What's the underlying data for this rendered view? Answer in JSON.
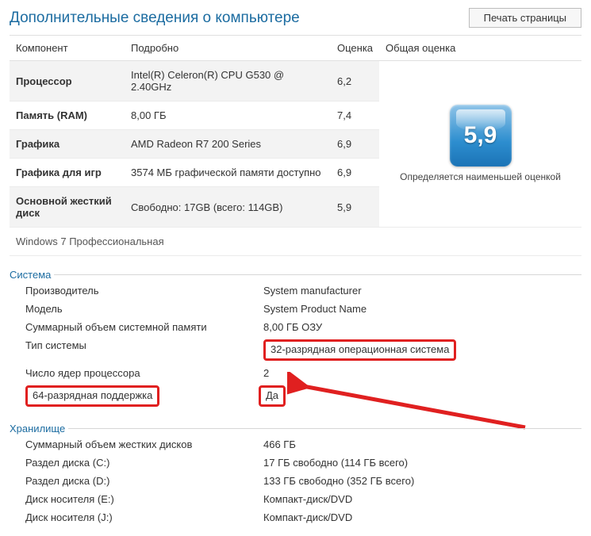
{
  "header": {
    "title": "Дополнительные сведения о компьютере",
    "print_button": "Печать страницы"
  },
  "table": {
    "headers": {
      "component": "Компонент",
      "detail": "Подробно",
      "score": "Оценка",
      "overall": "Общая оценка"
    },
    "rows": [
      {
        "comp": "Процессор",
        "detail": "Intel(R) Celeron(R) CPU G530 @ 2.40GHz",
        "score": "6,2"
      },
      {
        "comp": "Память (RAM)",
        "detail": "8,00 ГБ",
        "score": "7,4"
      },
      {
        "comp": "Графика",
        "detail": "AMD Radeon R7 200 Series",
        "score": "6,9"
      },
      {
        "comp": "Графика для игр",
        "detail": "3574 МБ графической памяти доступно",
        "score": "6,9"
      },
      {
        "comp": "Основной жесткий диск",
        "detail": "Свободно: 17GB (всего: 114GB)",
        "score": "5,9"
      }
    ],
    "overall_score": "5,9",
    "overall_caption": "Определяется наименьшей оценкой",
    "footer": "Windows 7 Профессиональная"
  },
  "system": {
    "title": "Система",
    "rows": [
      {
        "k": "Производитель",
        "v": "System manufacturer"
      },
      {
        "k": "Модель",
        "v": "System Product Name"
      },
      {
        "k": "Суммарный объем системной памяти",
        "v": "8,00 ГБ ОЗУ"
      },
      {
        "k": "Тип системы",
        "v": "32-разрядная операционная система"
      },
      {
        "k": "Число ядер процессора",
        "v": "2"
      },
      {
        "k": "64-разрядная поддержка",
        "v": "Да"
      }
    ]
  },
  "storage": {
    "title": "Хранилище",
    "rows": [
      {
        "k": "Суммарный объем жестких дисков",
        "v": "466 ГБ"
      },
      {
        "k": "Раздел диска (C:)",
        "v": "17 ГБ свободно (114 ГБ всего)"
      },
      {
        "k": "Раздел диска (D:)",
        "v": "133 ГБ свободно (352 ГБ всего)"
      },
      {
        "k": "Диск носителя (E:)",
        "v": "Компакт-диск/DVD"
      },
      {
        "k": "Диск носителя (J:)",
        "v": "Компакт-диск/DVD"
      }
    ]
  }
}
